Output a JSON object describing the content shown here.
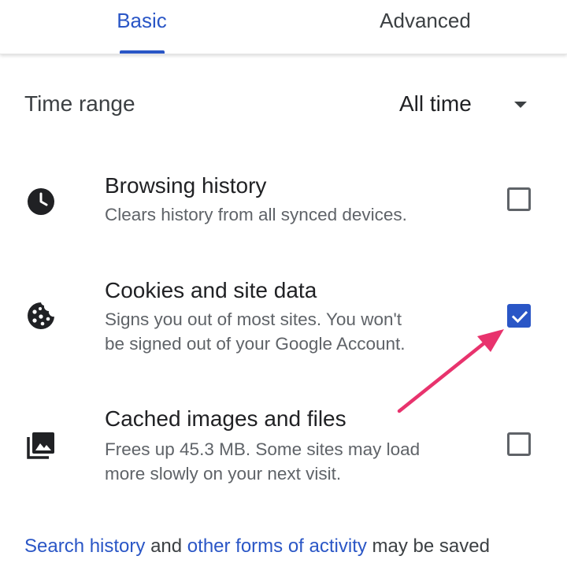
{
  "tabs": [
    {
      "label": "Basic",
      "selected": true
    },
    {
      "label": "Advanced",
      "selected": false
    }
  ],
  "time_range": {
    "label": "Time range",
    "value": "All time"
  },
  "items": [
    {
      "title": "Browsing history",
      "description": [
        "Clears history from all synced devices."
      ],
      "icon": "clock-icon",
      "checked": false
    },
    {
      "title": "Cookies and site data",
      "description": [
        "Signs you out of most sites. You won't",
        "be signed out of your Google Account."
      ],
      "icon": "cookie-icon",
      "checked": true
    },
    {
      "title": "Cached images and files",
      "description": [
        "Frees up 45.3 MB. Some sites may load",
        "more slowly on your next visit."
      ],
      "icon": "image-icon",
      "checked": false
    }
  ],
  "footer": {
    "link1": "Search history",
    "text1": " and ",
    "link2": "other forms of activity",
    "text2": " may be saved"
  },
  "colors": {
    "accent": "#2a56c6",
    "annotation_arrow": "#e8336d"
  }
}
